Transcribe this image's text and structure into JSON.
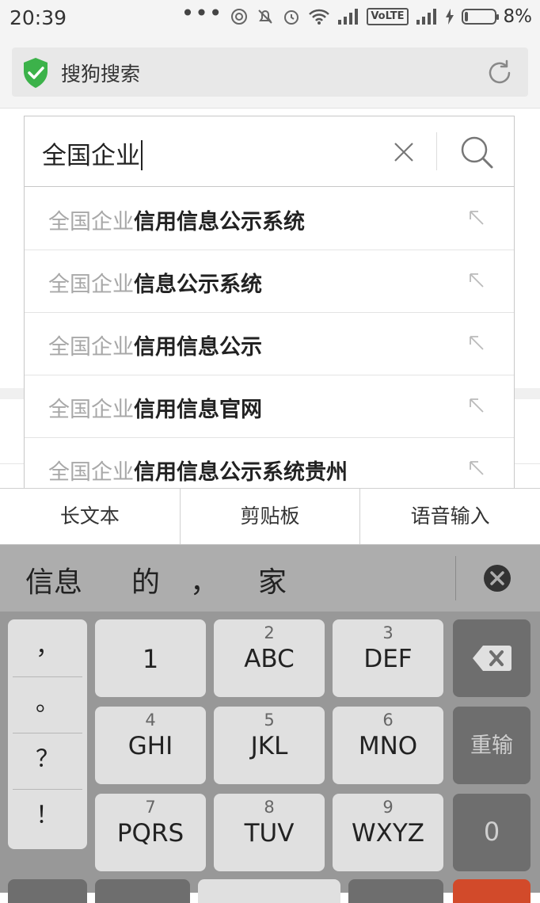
{
  "status_bar": {
    "time": "20:39",
    "network_label": "VoLTE",
    "battery_percent": "8%"
  },
  "browser": {
    "title": "搜狗搜索",
    "icons": [
      "shield-check-icon",
      "refresh-icon"
    ]
  },
  "search": {
    "query": "全国企业",
    "icons": [
      "clear-icon",
      "search-icon"
    ]
  },
  "suggestions": [
    {
      "query_part": "全国企业",
      "suffix": "信用信息公示系统"
    },
    {
      "query_part": "全国企业",
      "suffix": "信息公示系统"
    },
    {
      "query_part": "全国企业",
      "suffix": "信用信息公示"
    },
    {
      "query_part": "全国企业",
      "suffix": "信用信息官网"
    },
    {
      "query_part": "全国企业",
      "suffix": "信用信息公示系统贵州"
    }
  ],
  "keyboard_toolbar": [
    "长文本",
    "剪贴板",
    "语音输入"
  ],
  "candidates": [
    "信息",
    "的",
    "，",
    "家"
  ],
  "punctuation": [
    "，",
    "。",
    "？",
    "！"
  ],
  "keys": [
    {
      "num": "",
      "label": "1"
    },
    {
      "num": "2",
      "label": "ABC"
    },
    {
      "num": "3",
      "label": "DEF"
    },
    {
      "num": "4",
      "label": "GHI"
    },
    {
      "num": "5",
      "label": "JKL"
    },
    {
      "num": "6",
      "label": "MNO"
    },
    {
      "num": "7",
      "label": "PQRS"
    },
    {
      "num": "8",
      "label": "TUV"
    },
    {
      "num": "9",
      "label": "WXYZ"
    }
  ],
  "side_keys": {
    "reinput": "重输",
    "zero": "0",
    "backspace_icon": "backspace-icon"
  }
}
